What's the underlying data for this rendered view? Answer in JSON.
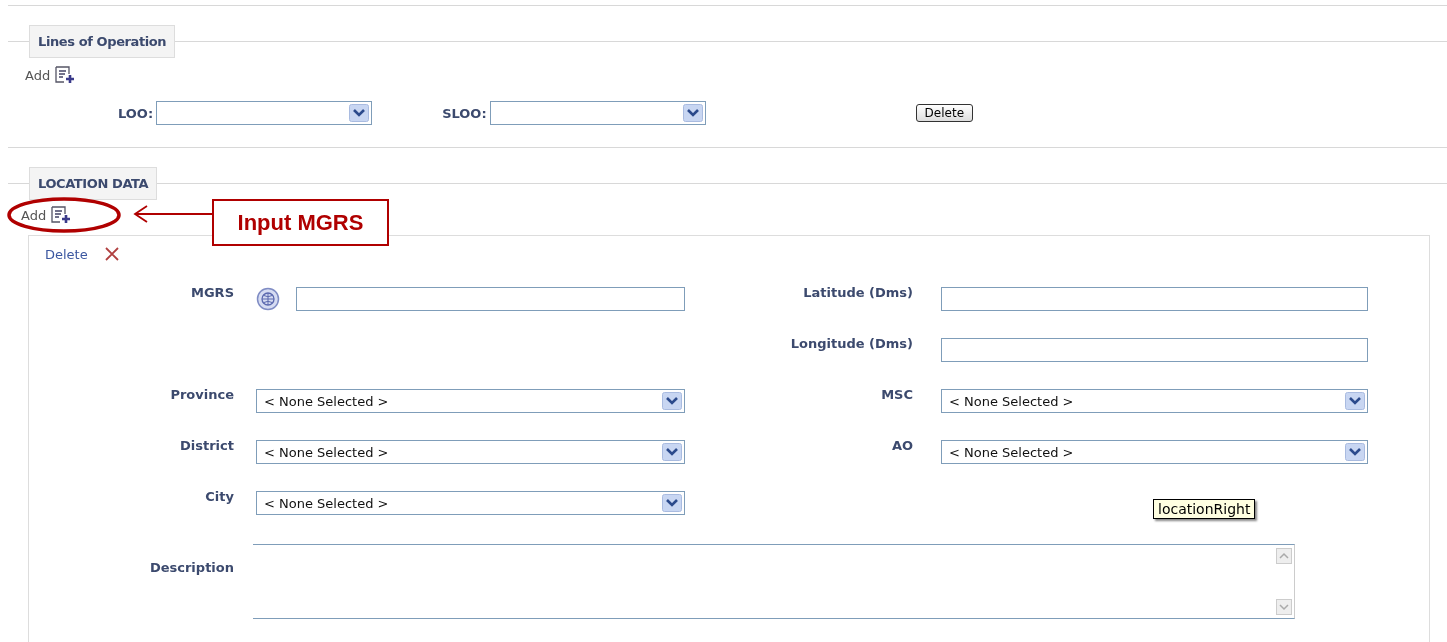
{
  "lines_of_operation": {
    "title": "Lines of Operation",
    "add_link": "Add",
    "fields": [
      {
        "label": "LOO:"
      },
      {
        "label": "SLOO:"
      }
    ],
    "delete_button": "Delete"
  },
  "location_data": {
    "title": "LOCATION DATA",
    "add_link": "Add",
    "entry": {
      "delete_link": "Delete",
      "rows": [
        {
          "left": {
            "label": "MGRS",
            "kind": "globe_text"
          },
          "right": {
            "label": "Latitude (Dms)",
            "kind": "text"
          }
        },
        {
          "right": {
            "label": "Longitude (Dms)",
            "kind": "text"
          }
        },
        {
          "left": {
            "label": "Province",
            "kind": "select",
            "value": "< None Selected >"
          },
          "right": {
            "label": "MSC",
            "kind": "select",
            "value": "< None Selected >"
          }
        },
        {
          "left": {
            "label": "District",
            "kind": "select",
            "value": "< None Selected >"
          },
          "right": {
            "label": "AO",
            "kind": "select",
            "value": "< None Selected >"
          }
        },
        {
          "left": {
            "label": "City",
            "kind": "select",
            "value": "< None Selected >"
          }
        },
        {
          "wide": {
            "label": "Description",
            "kind": "textarea"
          }
        }
      ]
    }
  },
  "annotation": {
    "callout": "Input MGRS"
  },
  "tooltip": {
    "text": "locationRight"
  }
}
